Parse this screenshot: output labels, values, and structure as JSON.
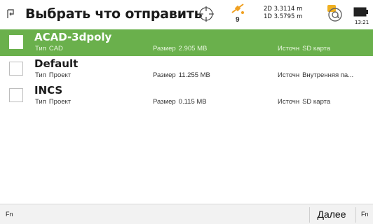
{
  "header": {
    "title": "Выбрать что отправить",
    "satellite_count": "9",
    "quality_2d": "2D 3.3114 m",
    "quality_1d": "1D 3.5795 m",
    "time": "13:21"
  },
  "items": [
    {
      "name": "ACAD-3dpoly",
      "type_label": "Тип",
      "type": "CAD",
      "size_label": "Размер",
      "size": "2.905 MB",
      "source_label": "Источн",
      "source": "SD карта",
      "selected": true
    },
    {
      "name": "Default",
      "type_label": "Тип",
      "type": "Проект",
      "size_label": "Размер",
      "size": "11.255 MB",
      "source_label": "Источн",
      "source": "Внутренняя па...",
      "selected": false
    },
    {
      "name": "INCS",
      "type_label": "Тип",
      "type": "Проект",
      "size_label": "Размер",
      "size": "0.115 MB",
      "source_label": "Источн",
      "source": "SD карта",
      "selected": false
    }
  ],
  "footer": {
    "fn_left": "Fn",
    "next_label": "Далее",
    "fn_right": "Fn"
  },
  "colors": {
    "selected_row": "#6ab04c",
    "satellite_accent": "#f0a020",
    "connection_accent": "#f0b020"
  },
  "icons": [
    "back-icon",
    "crosshair-icon",
    "satellite-icon",
    "connection-icon",
    "battery-icon"
  ]
}
